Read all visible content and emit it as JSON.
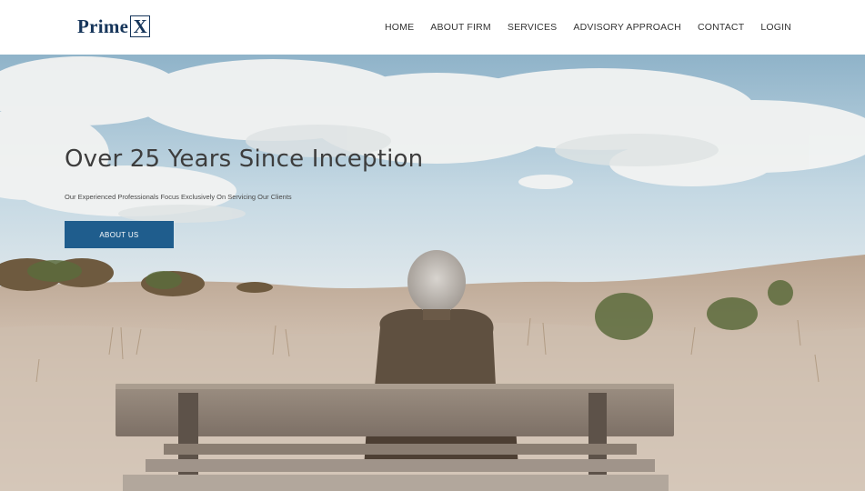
{
  "logo": {
    "text": "Prime",
    "box_letter": "X"
  },
  "nav": {
    "items": [
      "HOME",
      "ABOUT FIRM",
      "SERVICES",
      "ADVISORY APPROACH",
      "CONTACT",
      "LOGIN"
    ]
  },
  "hero": {
    "title": "Over 25 Years Since Inception",
    "subtitle": "Our Experienced Professionals Focus Exclusively On Servicing Our Clients",
    "button_label": "ABOUT US"
  },
  "colors": {
    "brand_navy": "#16355a",
    "button_blue": "#1f5d8d",
    "nav_text": "#333333"
  }
}
